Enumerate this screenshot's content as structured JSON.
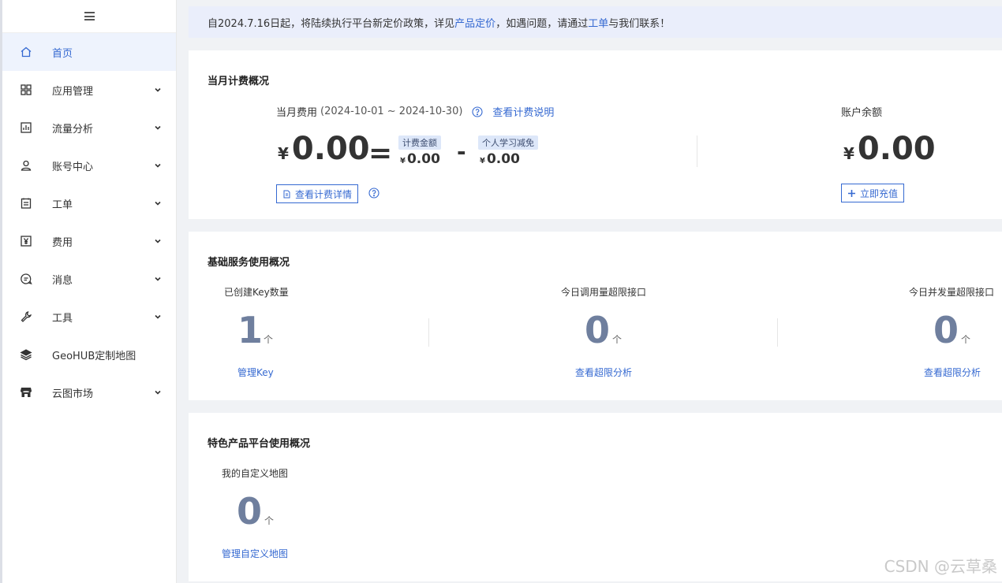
{
  "sidebar": {
    "items": [
      {
        "label": "首页",
        "icon": "home-icon",
        "active": true,
        "expandable": false
      },
      {
        "label": "应用管理",
        "icon": "grid-icon",
        "expandable": true
      },
      {
        "label": "流量分析",
        "icon": "chart-icon",
        "expandable": true
      },
      {
        "label": "账号中心",
        "icon": "user-icon",
        "expandable": true
      },
      {
        "label": "工单",
        "icon": "ticket-icon",
        "expandable": true
      },
      {
        "label": "费用",
        "icon": "yen-icon",
        "expandable": true
      },
      {
        "label": "消息",
        "icon": "message-icon",
        "expandable": true
      },
      {
        "label": "工具",
        "icon": "wrench-icon",
        "expandable": true
      },
      {
        "label": "GeoHUB定制地图",
        "icon": "layers-icon",
        "expandable": false
      },
      {
        "label": "云图市场",
        "icon": "store-icon",
        "expandable": true
      }
    ]
  },
  "notice": {
    "prefix": "自2024.7.16日起，将陆续执行平台新定价政策，详见",
    "link1": "产品定价",
    "middle": "，如遇问题，请通过",
    "link2": "工单",
    "suffix": "与我们联系！"
  },
  "billing": {
    "title": "当月计费概况",
    "fee_label": "当月费用",
    "range": "(2024-10-01 ~ 2024-10-30)",
    "explain_link": "查看计费说明",
    "currency": "¥",
    "total": "0.00",
    "equals": "=",
    "minus": "-",
    "billed_tag": "计费金额",
    "billed_amount": "0.00",
    "relief_tag": "个人学习减免",
    "relief_amount": "0.00",
    "details_button": "查看计费详情",
    "balance_label": "账户余额",
    "balance": "0.00",
    "recharge_button": "立即充值"
  },
  "basic": {
    "title": "基础服务使用概况",
    "stats": [
      {
        "label": "已创建Key数量",
        "value": "1",
        "unit": "个",
        "link": "管理Key"
      },
      {
        "label": "今日调用量超限接口",
        "value": "0",
        "unit": "个",
        "link": "查看超限分析"
      },
      {
        "label": "今日并发量超限接口",
        "value": "0",
        "unit": "个",
        "link": "查看超限分析"
      }
    ]
  },
  "feature": {
    "title": "特色产品平台使用概况",
    "stat": {
      "label": "我的自定义地图",
      "value": "0",
      "unit": "个",
      "link": "管理自定义地图"
    }
  },
  "watermark": "CSDN @云草桑",
  "colors": {
    "accent": "#3569d1",
    "stat_value": "#6f7f9e",
    "notice_bg": "#eaeefb"
  }
}
